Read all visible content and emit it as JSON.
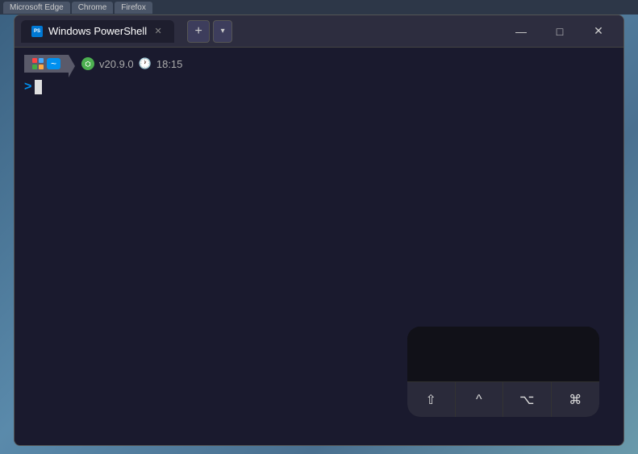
{
  "desktop": {
    "taskbar_tabs": [
      "Microsoft Edge",
      "Chrome",
      "Firefox"
    ]
  },
  "window": {
    "title": "Windows PowerShell",
    "tab_label": "Windows PowerShell",
    "icon": "ps-logo"
  },
  "controls": {
    "new_tab_label": "+",
    "dropdown_label": "▾",
    "minimize_label": "—",
    "maximize_label": "□",
    "close_label": "✕",
    "close_tab_label": "✕"
  },
  "prompt": {
    "segment_gray_icon": "windows-icon",
    "segment_blue_label": "~",
    "segment_version": "v20.9.0",
    "segment_time": "18:15",
    "arrow": ">",
    "tilde": "~"
  },
  "keyboard": {
    "shift_symbol": "⇧",
    "ctrl_symbol": "^",
    "alt_symbol": "⌥",
    "cmd_symbol": "⌘"
  }
}
